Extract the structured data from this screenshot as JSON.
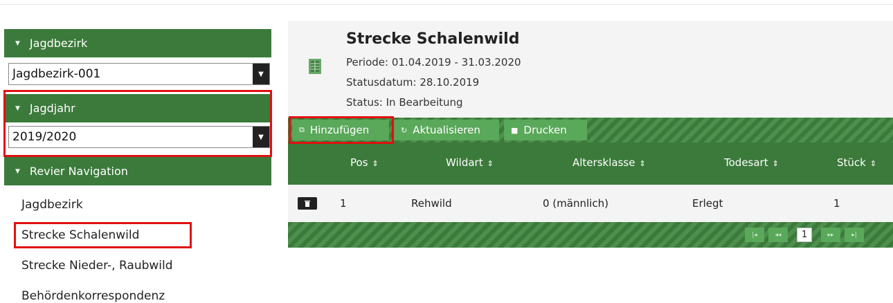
{
  "sidebar": {
    "jagdbezirk": {
      "header": "Jagdbezirk",
      "selected": "Jagdbezirk-001"
    },
    "jagdjahr": {
      "header": "Jagdjahr",
      "selected": "2019/2020"
    },
    "revier_navigation": {
      "header": "Revier Navigation",
      "links": [
        "Jagdbezirk",
        "Strecke Schalenwild",
        "Strecke Nieder-, Raubwild",
        "Behördenkorrespondenz"
      ]
    }
  },
  "main": {
    "title": "Strecke Schalenwild",
    "periode": "Periode: 01.04.2019 - 31.03.2020",
    "statusdatum": "Statusdatum: 28.10.2019",
    "status": "Status: In Bearbeitung",
    "toolbar": {
      "add_label": "Hinzufügen",
      "refresh_label": "Aktualisieren",
      "print_label": "Drucken"
    },
    "table": {
      "columns": [
        "Pos",
        "Wildart",
        "Altersklasse",
        "Todesart",
        "Stück"
      ],
      "rows": [
        {
          "pos": "1",
          "wildart": "Rehwild",
          "altersklasse": "0 (männlich)",
          "todesart": "Erlegt",
          "stueck": "1"
        }
      ]
    },
    "pager": {
      "current_page": "1"
    }
  },
  "colors": {
    "header_green": "#3b7a3b",
    "button_green": "#5aa85a",
    "highlight_red": "#e01010"
  },
  "icons": [
    "chevron-down-icon",
    "dropdown-arrow-icon",
    "document-icon",
    "add-icon",
    "refresh-icon",
    "print-icon",
    "trash-icon",
    "sort-icon",
    "first-page-icon",
    "prev-page-icon",
    "next-page-icon",
    "last-page-icon"
  ]
}
